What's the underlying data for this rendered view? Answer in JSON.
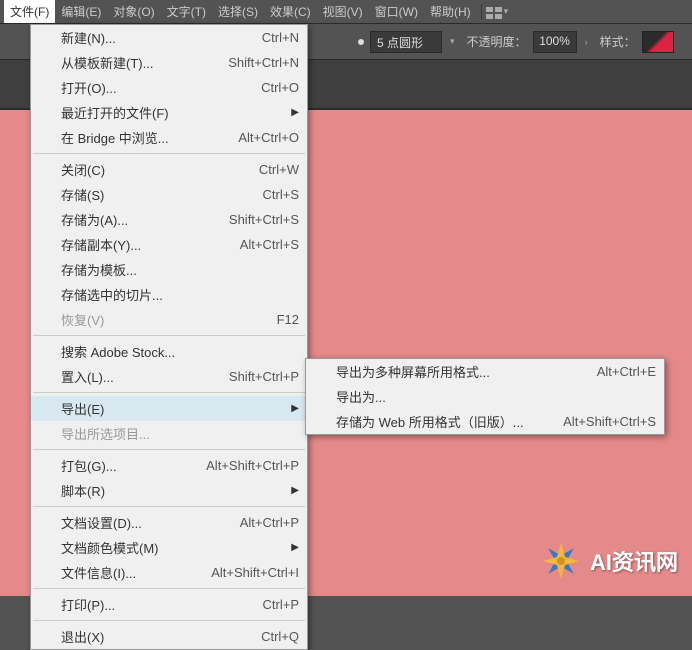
{
  "menubar": {
    "items": [
      "文件(F)",
      "编辑(E)",
      "对象(O)",
      "文字(T)",
      "选择(S)",
      "效果(C)",
      "视图(V)",
      "窗口(W)",
      "帮助(H)"
    ]
  },
  "toolbar": {
    "stroke_shape": "5 点圆形",
    "opacity_label": "不透明度：",
    "opacity_value": "100%",
    "style_label": "样式："
  },
  "file_menu": [
    {
      "label": "新建(N)...",
      "shortcut": "Ctrl+N"
    },
    {
      "label": "从模板新建(T)...",
      "shortcut": "Shift+Ctrl+N"
    },
    {
      "label": "打开(O)...",
      "shortcut": "Ctrl+O"
    },
    {
      "label": "最近打开的文件(F)",
      "sub": true
    },
    {
      "label": "在 Bridge 中浏览...",
      "shortcut": "Alt+Ctrl+O"
    },
    {
      "sep": true
    },
    {
      "label": "关闭(C)",
      "shortcut": "Ctrl+W"
    },
    {
      "label": "存储(S)",
      "shortcut": "Ctrl+S"
    },
    {
      "label": "存储为(A)...",
      "shortcut": "Shift+Ctrl+S"
    },
    {
      "label": "存储副本(Y)...",
      "shortcut": "Alt+Ctrl+S"
    },
    {
      "label": "存储为模板..."
    },
    {
      "label": "存储选中的切片..."
    },
    {
      "label": "恢复(V)",
      "shortcut": "F12",
      "disabled": true
    },
    {
      "sep": true
    },
    {
      "label": "搜索 Adobe Stock..."
    },
    {
      "label": "置入(L)...",
      "shortcut": "Shift+Ctrl+P"
    },
    {
      "sep": true
    },
    {
      "label": "导出(E)",
      "sub": true,
      "hl": true
    },
    {
      "label": "导出所选项目...",
      "disabled": true
    },
    {
      "sep": true
    },
    {
      "label": "打包(G)...",
      "shortcut": "Alt+Shift+Ctrl+P"
    },
    {
      "label": "脚本(R)",
      "sub": true
    },
    {
      "sep": true
    },
    {
      "label": "文档设置(D)...",
      "shortcut": "Alt+Ctrl+P"
    },
    {
      "label": "文档颜色模式(M)",
      "sub": true
    },
    {
      "label": "文件信息(I)...",
      "shortcut": "Alt+Shift+Ctrl+I"
    },
    {
      "sep": true
    },
    {
      "label": "打印(P)...",
      "shortcut": "Ctrl+P"
    },
    {
      "sep": true
    },
    {
      "label": "退出(X)",
      "shortcut": "Ctrl+Q"
    }
  ],
  "export_menu": [
    {
      "label": "导出为多种屏幕所用格式...",
      "shortcut": "Alt+Ctrl+E"
    },
    {
      "label": "导出为...",
      "box": true
    },
    {
      "label": "存储为 Web 所用格式（旧版）...",
      "shortcut": "Alt+Shift+Ctrl+S"
    }
  ],
  "logo": {
    "text": "AI资讯网"
  }
}
